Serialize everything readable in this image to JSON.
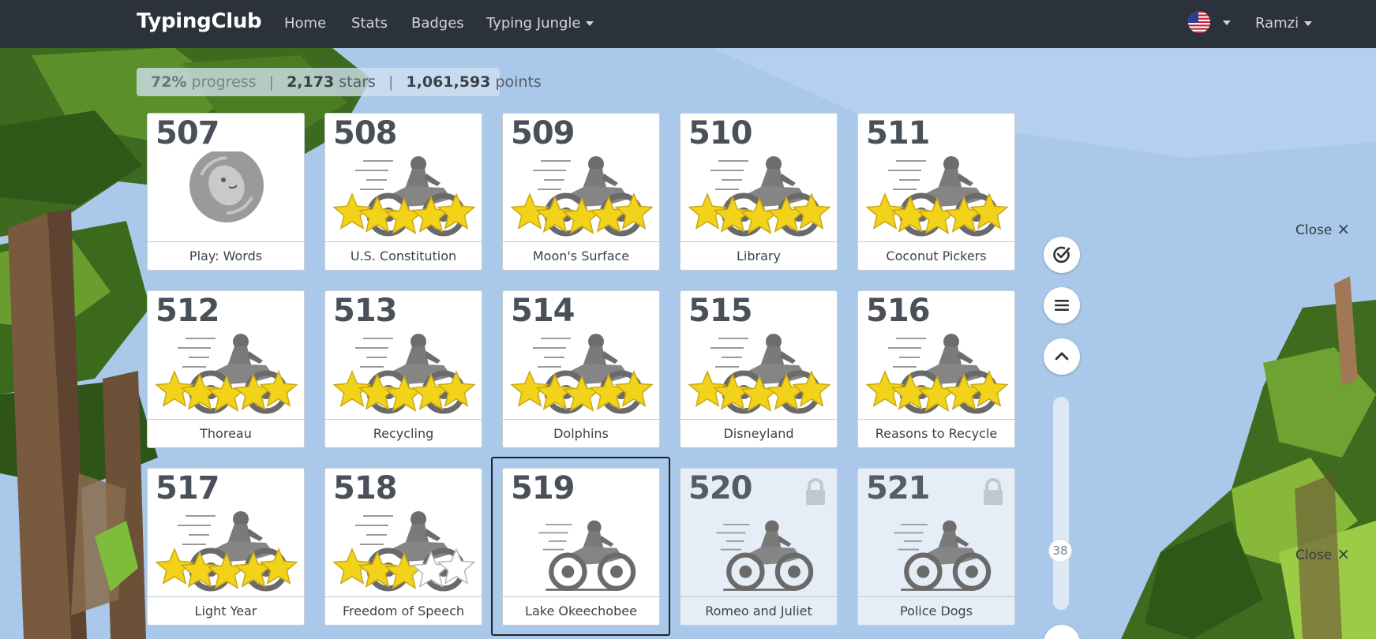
{
  "navbar": {
    "brand": "TypingClub",
    "links": [
      "Home",
      "Stats",
      "Badges",
      "Typing Jungle"
    ],
    "user": "Ramzi"
  },
  "progress": {
    "percent": "72%",
    "percent_label": "progress",
    "stars": "2,173",
    "stars_label": "stars",
    "points": "1,061,593",
    "points_label": "points"
  },
  "lessons": [
    {
      "num": "507",
      "title": "Play: Words",
      "kind": "game",
      "stars": 0,
      "locked": false
    },
    {
      "num": "508",
      "title": "U.S. Constitution",
      "kind": "bike",
      "stars": 5,
      "locked": false
    },
    {
      "num": "509",
      "title": "Moon's Surface",
      "kind": "bike",
      "stars": 5,
      "locked": false
    },
    {
      "num": "510",
      "title": "Library",
      "kind": "bike",
      "stars": 5,
      "locked": false
    },
    {
      "num": "511",
      "title": "Coconut Pickers",
      "kind": "bike",
      "stars": 5,
      "locked": false
    },
    {
      "num": "512",
      "title": "Thoreau",
      "kind": "bike",
      "stars": 5,
      "locked": false
    },
    {
      "num": "513",
      "title": "Recycling",
      "kind": "bike",
      "stars": 5,
      "locked": false
    },
    {
      "num": "514",
      "title": "Dolphins",
      "kind": "bike",
      "stars": 5,
      "locked": false
    },
    {
      "num": "515",
      "title": "Disneyland",
      "kind": "bike",
      "stars": 5,
      "locked": false
    },
    {
      "num": "516",
      "title": "Reasons to Recycle",
      "kind": "bike",
      "stars": 5,
      "locked": false
    },
    {
      "num": "517",
      "title": "Light Year",
      "kind": "bike",
      "stars": 5,
      "locked": false
    },
    {
      "num": "518",
      "title": "Freedom of Speech",
      "kind": "bike",
      "stars": 3,
      "locked": false
    },
    {
      "num": "519",
      "title": "Lake Okeechobee",
      "kind": "bike-nostars",
      "stars": 0,
      "locked": false,
      "selected": true
    },
    {
      "num": "520",
      "title": "Romeo and Juliet",
      "kind": "bike-nostars",
      "stars": 0,
      "locked": true
    },
    {
      "num": "521",
      "title": "Police Dogs",
      "kind": "bike-nostars",
      "stars": 0,
      "locked": true
    }
  ],
  "side": {
    "scroll_value": "38",
    "close_label": "Close"
  },
  "colors": {
    "navbar": "#2b323b",
    "star": "#f2d319",
    "sky": "#a9c9ea"
  }
}
